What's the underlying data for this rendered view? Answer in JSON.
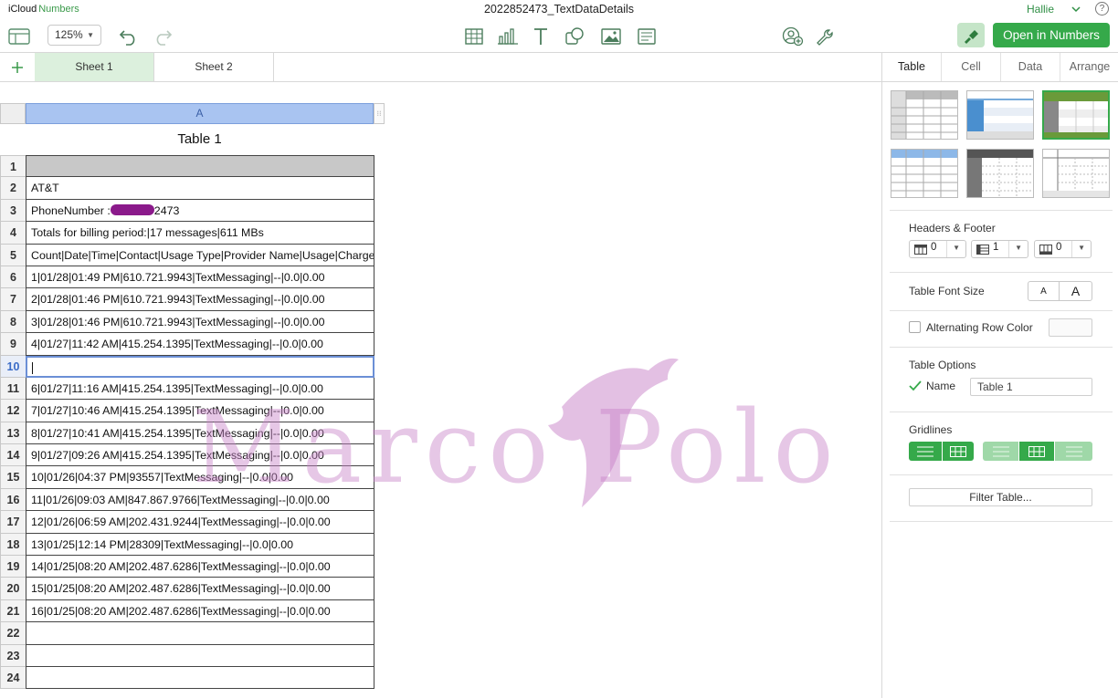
{
  "app": {
    "brand_main": "iCloud",
    "brand_sub": "Numbers"
  },
  "document": {
    "title": "2022852473_TextDataDetails"
  },
  "user": {
    "name": "Hallie"
  },
  "toolbar": {
    "zoom": "125%",
    "open_button": "Open in Numbers"
  },
  "sheets": [
    {
      "label": "Sheet 1",
      "active": true
    },
    {
      "label": "Sheet 2",
      "active": false
    }
  ],
  "table": {
    "title": "Table 1",
    "column_header": "A",
    "row_numbers": [
      "1",
      "2",
      "3",
      "4",
      "5",
      "6",
      "7",
      "8",
      "9",
      "10",
      "11",
      "12",
      "13",
      "14",
      "15",
      "16",
      "17",
      "18",
      "19",
      "20",
      "21",
      "22",
      "23",
      "24"
    ],
    "phone_prefix": "PhoneNumber :",
    "phone_suffix": "2473",
    "rows": [
      "",
      "AT&T",
      "PhoneNumber :2473",
      "Totals for billing period:|17 messages|611 MBs",
      "Count|Date|Time|Contact|Usage Type|Provider Name|Usage|Charges",
      "1|01/28|01:49 PM|610.721.9943|TextMessaging|--|0.0|0.00",
      "2|01/28|01:46 PM|610.721.9943|TextMessaging|--|0.0|0.00",
      "3|01/28|01:46 PM|610.721.9943|TextMessaging|--|0.0|0.00",
      "4|01/27|11:42 AM|415.254.1395|TextMessaging|--|0.0|0.00",
      "",
      "6|01/27|11:16 AM|415.254.1395|TextMessaging|--|0.0|0.00",
      "7|01/27|10:46 AM|415.254.1395|TextMessaging|--|0.0|0.00",
      "8|01/27|10:41 AM|415.254.1395|TextMessaging|--|0.0|0.00",
      "9|01/27|09:26 AM|415.254.1395|TextMessaging|--|0.0|0.00",
      "10|01/26|04:37 PM|93557|TextMessaging|--|0.0|0.00",
      "11|01/26|09:03 AM|847.867.9766|TextMessaging|--|0.0|0.00",
      "12|01/26|06:59 AM|202.431.9244|TextMessaging|--|0.0|0.00",
      "13|01/25|12:14 PM|28309|TextMessaging|--|0.0|0.00",
      "14|01/25|08:20 AM|202.487.6286|TextMessaging|--|0.0|0.00",
      "15|01/25|08:20 AM|202.487.6286|TextMessaging|--|0.0|0.00",
      "16|01/25|08:20 AM|202.487.6286|TextMessaging|--|0.0|0.00",
      "",
      "",
      ""
    ],
    "selected_row": "10"
  },
  "watermark": {
    "text": "Marco Polo"
  },
  "panel": {
    "tabs": [
      "Table",
      "Cell",
      "Data",
      "Arrange"
    ],
    "active_tab": "Table",
    "headers_footer_label": "Headers & Footer",
    "header_rows": "0",
    "header_columns": "1",
    "footer_rows": "0",
    "font_size_label": "Table Font Size",
    "font_small": "A",
    "font_large": "A",
    "alternating_label": "Alternating Row Color",
    "table_options_label": "Table Options",
    "name_label": "Name",
    "name_value": "Table 1",
    "gridlines_label": "Gridlines",
    "filter_button": "Filter Table..."
  },
  "colors": {
    "accent": "#35a94a",
    "selection": "#a9c4f1",
    "redaction": "#8b1a8b"
  }
}
